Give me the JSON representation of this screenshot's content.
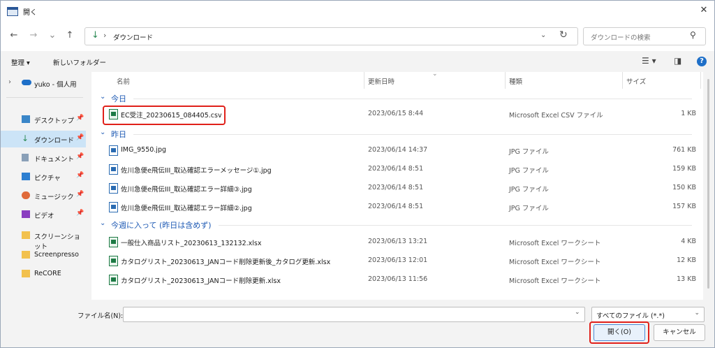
{
  "window": {
    "title": "開く"
  },
  "nav": {
    "back": "←",
    "forward": "→",
    "recent": "⌄",
    "up": "↑"
  },
  "address": {
    "crumb": "ダウンロード",
    "separator": "›"
  },
  "search": {
    "placeholder": "ダウンロードの検索"
  },
  "toolbar": {
    "organize": "整理 ▾",
    "new_folder": "新しいフォルダー"
  },
  "sidebar": [
    {
      "label": "yuko - 個人用",
      "icon": "cloud-icon"
    },
    {
      "label": "デスクトップ",
      "icon": "desktop-icon",
      "pin": true
    },
    {
      "label": "ダウンロード",
      "icon": "download-icon",
      "pin": true,
      "selected": true
    },
    {
      "label": "ドキュメント",
      "icon": "document-icon",
      "pin": true
    },
    {
      "label": "ピクチャ",
      "icon": "pictures-icon",
      "pin": true
    },
    {
      "label": "ミュージック",
      "icon": "music-icon",
      "pin": true
    },
    {
      "label": "ビデオ",
      "icon": "video-icon",
      "pin": true
    },
    {
      "label": "スクリーンショット",
      "icon": "folder-icon"
    },
    {
      "label": "Screenpresso",
      "icon": "folder-icon"
    },
    {
      "label": "ReCORE",
      "icon": "folder-icon"
    }
  ],
  "columns": {
    "name": "名前",
    "date": "更新日時",
    "type": "種類",
    "size": "サイズ"
  },
  "groups": [
    {
      "label": "今日",
      "files": [
        {
          "name": "EC受注_20230615_084405.csv",
          "date": "2023/06/15 8:44",
          "type": "Microsoft Excel CSV ファイル",
          "size": "1 KB",
          "kind": "excel"
        }
      ]
    },
    {
      "label": "昨日",
      "files": [
        {
          "name": "IMG_9550.jpg",
          "date": "2023/06/14 14:37",
          "type": "JPG ファイル",
          "size": "761 KB",
          "kind": "image"
        },
        {
          "name": "佐川急便e飛伝III_取込確認エラーメッセージ①.jpg",
          "date": "2023/06/14 8:51",
          "type": "JPG ファイル",
          "size": "159 KB",
          "kind": "image"
        },
        {
          "name": "佐川急便e飛伝III_取込確認エラー詳細③.jpg",
          "date": "2023/06/14 8:51",
          "type": "JPG ファイル",
          "size": "150 KB",
          "kind": "image"
        },
        {
          "name": "佐川急便e飛伝III_取込確認エラー詳細②.jpg",
          "date": "2023/06/14 8:51",
          "type": "JPG ファイル",
          "size": "157 KB",
          "kind": "image"
        }
      ]
    },
    {
      "label": "今週に入って (昨日は含めず)",
      "files": [
        {
          "name": "一般仕入商品リスト_20230613_132132.xlsx",
          "date": "2023/06/13 13:21",
          "type": "Microsoft Excel ワークシート",
          "size": "4 KB",
          "kind": "excel"
        },
        {
          "name": "カタログリスト_20230613_JANコード削除更新後_カタログ更新.xlsx",
          "date": "2023/06/13 12:01",
          "type": "Microsoft Excel ワークシート",
          "size": "12 KB",
          "kind": "excel"
        },
        {
          "name": "カタログリスト_20230613_JANコード削除更新.xlsx",
          "date": "2023/06/13 11:56",
          "type": "Microsoft Excel ワークシート",
          "size": "13 KB",
          "kind": "excel"
        }
      ]
    }
  ],
  "footer": {
    "filename_label": "ファイル名(N):",
    "filename_value": "",
    "filetype": "すべてのファイル (*.*)",
    "open_label": "開く(O)",
    "cancel_label": "キャンセル"
  },
  "colors": {
    "accent": "#1e5ab4",
    "highlight": "#e0201a",
    "selected": "#cce4f7"
  }
}
